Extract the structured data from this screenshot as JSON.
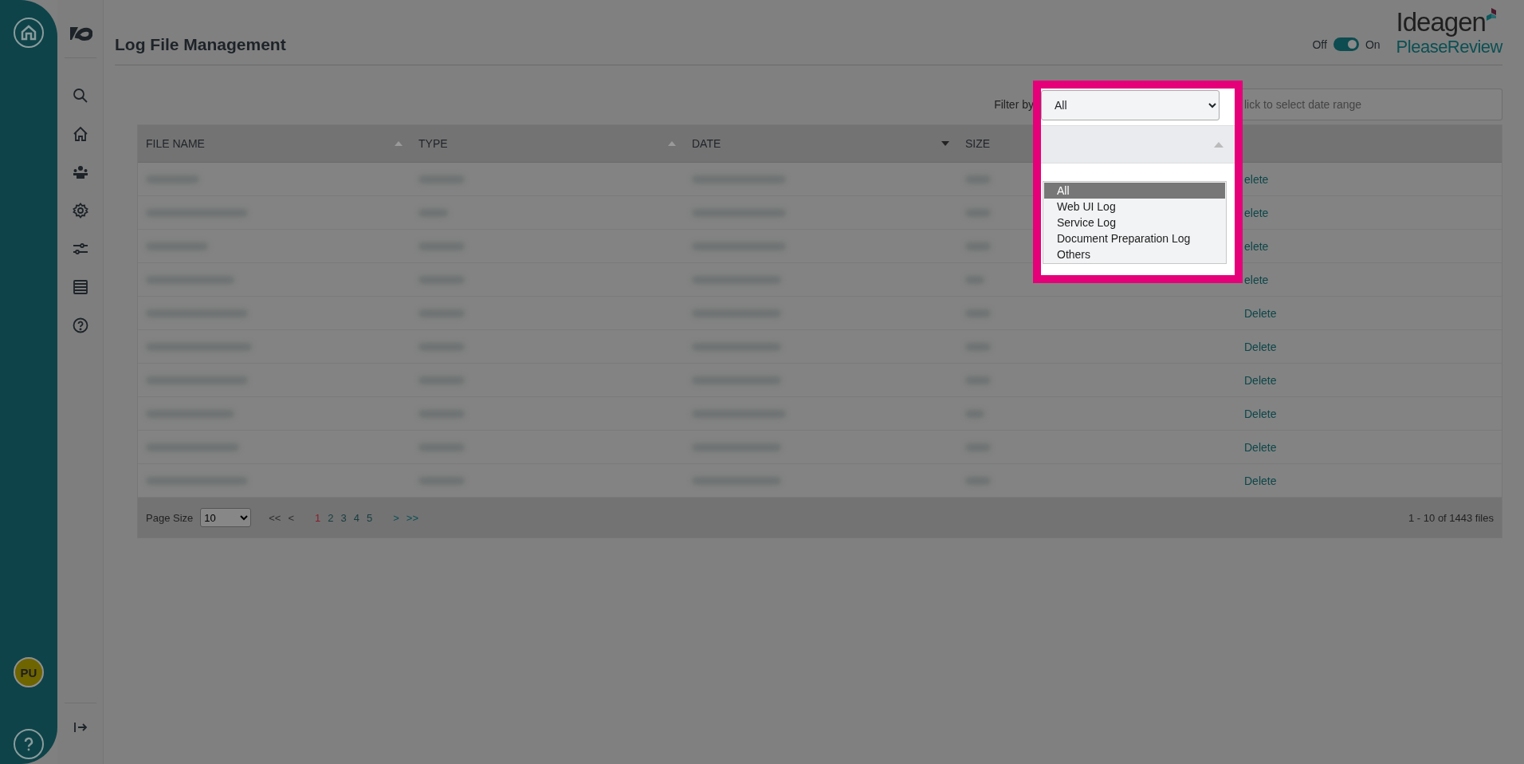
{
  "header": {
    "title": "Log File Management",
    "toggle": {
      "off_label": "Off",
      "on_label": "On",
      "on": true
    },
    "logo": {
      "brand": "Ideagen",
      "product": "PleaseReview"
    }
  },
  "user": {
    "initials": "PU"
  },
  "filter": {
    "label": "Filter by",
    "select_value": "All",
    "date_placeholder": "lick to select date range",
    "options": [
      {
        "label": "All",
        "selected": true
      },
      {
        "label": "Web UI Log",
        "selected": false
      },
      {
        "label": "Service Log",
        "selected": false
      },
      {
        "label": "Document Preparation Log",
        "selected": false
      },
      {
        "label": "Others",
        "selected": false
      }
    ]
  },
  "table": {
    "columns": [
      {
        "label": "FILE NAME",
        "kind": "sortable"
      },
      {
        "label": "TYPE",
        "kind": "sortable"
      },
      {
        "label": "DATE",
        "kind": "sorted"
      },
      {
        "label": "SIZE",
        "kind": "plain"
      }
    ],
    "rows": [
      {
        "action": "elete"
      },
      {
        "action": "elete"
      },
      {
        "action": "elete"
      },
      {
        "action": "elete"
      },
      {
        "action": "Delete"
      },
      {
        "action": "Delete"
      },
      {
        "action": "Delete"
      },
      {
        "action": "Delete"
      },
      {
        "action": "Delete"
      },
      {
        "action": "Delete"
      }
    ]
  },
  "pagination": {
    "page_size_label": "Page Size",
    "page_size": "10",
    "first": {
      "label": "<<",
      "disabled": true
    },
    "prev": {
      "label": "<",
      "disabled": true
    },
    "pages": [
      {
        "label": "1",
        "selected": true
      },
      {
        "label": "2",
        "selected": false
      },
      {
        "label": "3",
        "selected": false
      },
      {
        "label": "4",
        "selected": false
      },
      {
        "label": "5",
        "selected": false
      }
    ],
    "next": {
      "label": ">",
      "disabled": false
    },
    "last": {
      "label": ">>",
      "disabled": false
    },
    "summary": "1 - 10 of 1443 files"
  }
}
